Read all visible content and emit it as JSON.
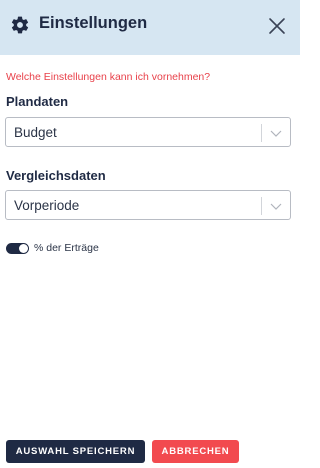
{
  "header": {
    "title": "Einstellungen",
    "icon": "gear-icon",
    "close_icon": "close-icon"
  },
  "help_link": "Welche Einstellungen kann ich vornehmen?",
  "plandaten": {
    "label": "Plandaten",
    "selected": "Budget"
  },
  "vergleichsdaten": {
    "label": "Vergleichsdaten",
    "selected": "Vorperiode"
  },
  "toggle": {
    "label": "% der Erträge",
    "on": true
  },
  "buttons": {
    "save": "AUSWAHL SPEICHERN",
    "cancel": "ABBRECHEN"
  },
  "colors": {
    "header_bg": "#d6e6f2",
    "primary": "#1f2a44",
    "accent": "#f24a4f",
    "link": "#e8414a"
  }
}
